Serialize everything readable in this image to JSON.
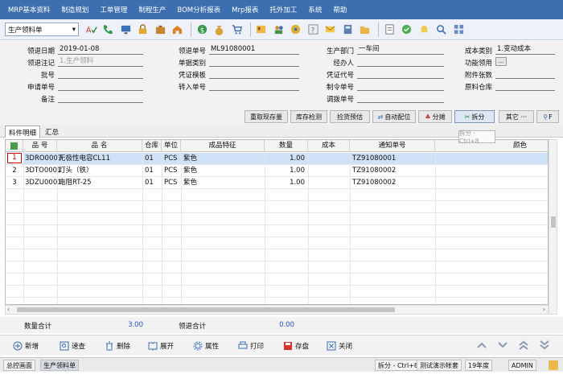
{
  "menu": [
    "MRP基本资料",
    "制造规划",
    "工单管理",
    "制程生产",
    "BOM分析报表",
    "Mrp报表",
    "托外加工",
    "系统",
    "帮助"
  ],
  "toolbar": {
    "doc_type": "生产领料单",
    "icons": [
      "spell-check-icon",
      "phone-icon",
      "monitor-icon",
      "lock-icon",
      "briefcase-icon",
      "home-icon",
      "dollar-icon",
      "money-bag-icon",
      "cart-icon",
      "id-card-icon",
      "users-icon",
      "puzzle-icon",
      "help-icon",
      "mail-icon",
      "calculator-icon",
      "folder-icon",
      "document-icon",
      "check-circle-icon",
      "bell-icon",
      "search-icon",
      "grid-icon"
    ]
  },
  "form": {
    "receive_date_label": "领退日期",
    "receive_date": "2019-01-08",
    "receive_flag_label": "领退注记",
    "receive_flag": "1.生产领料",
    "batch_label": "批号",
    "apply_no_label": "申请单号",
    "remark_label": "备注",
    "receive_no_label": "领退单号",
    "receive_no": "ML91080001",
    "doc_category_label": "单据类别",
    "voucher_label": "凭证模板",
    "transfer_no_label": "转入单号",
    "dept_label": "生产部门",
    "dept": "一车间",
    "handler_label": "经办人",
    "voucher_code_label": "凭证代号",
    "order_no_label": "制令单号",
    "alloc_no_label": "调拨单号",
    "cost_type_label": "成本类别",
    "cost_type": "1.变动成本",
    "process_label": "功能领用",
    "process_btn": "...",
    "attach_label": "附件张数",
    "warehouse_label": "原料仓库"
  },
  "actions": [
    "重取现存量",
    "库存检测",
    "捡货预估",
    "自动配位",
    "分摊",
    "拆分",
    "其它 ···",
    "F"
  ],
  "tooltip": "拆分 - Ctrl+8",
  "tabs": [
    "料件明细",
    "汇总"
  ],
  "grid": {
    "headers": [
      "",
      "品 号",
      "品 名",
      "仓库",
      "单位",
      "成品特征",
      "数量",
      "成本",
      "通知单号",
      "颜色"
    ],
    "rows": [
      {
        "n": "1",
        "code": "3DRO0007",
        "name": "无极性电容CL11",
        "wh": "01",
        "unit": "PCS",
        "feature": "紫色",
        "qty": "1.00",
        "cost": "",
        "notice": "TZ91080001",
        "color": ""
      },
      {
        "n": "2",
        "code": "3DTO0001",
        "name": "灯头（铁）",
        "wh": "01",
        "unit": "PCS",
        "feature": "紫色",
        "qty": "1.00",
        "cost": "",
        "notice": "TZ91080002",
        "color": ""
      },
      {
        "n": "3",
        "code": "3DZU0001",
        "name": "电阻RT-25",
        "wh": "01",
        "unit": "PCS",
        "feature": "紫色",
        "qty": "1.00",
        "cost": "",
        "notice": "TZ91080002",
        "color": ""
      }
    ]
  },
  "footer": {
    "qty_total_label": "数量合计",
    "qty_total": "3.00",
    "return_total_label": "领退合计",
    "return_total": "0.00"
  },
  "bottom_buttons": [
    "新增",
    "速查",
    "删除",
    "展开",
    "属性",
    "打印",
    "存盘",
    "关闭"
  ],
  "status": {
    "tab1": "总控画面",
    "tab2": "生产领料单",
    "hint": "拆分 - Ctrl+8",
    "account": "测试演示帐套",
    "year": "19年度",
    "user": "ADMIN"
  },
  "colors": {
    "menubar": "#3d6fb0",
    "selection": "#cfe1f7",
    "total": "#1f4fd1"
  }
}
